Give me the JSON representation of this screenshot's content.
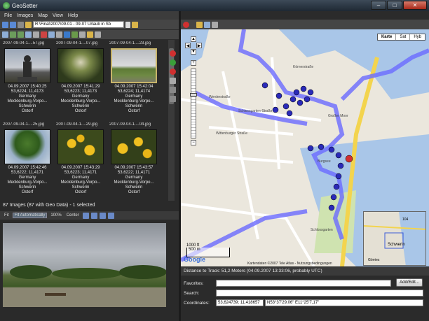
{
  "window": {
    "title": "GeoSetter",
    "minimize": "–",
    "maximize": "□",
    "close": "✕"
  },
  "menu": [
    "File",
    "Images",
    "Map",
    "View",
    "Help"
  ],
  "toolbar": {
    "path": "R:\\Final\\2007\\09-01 - 09-07 Urlaub in Sb"
  },
  "thumbnails": [
    {
      "file": "2007-09-04-1....57.jpg",
      "date": "04.09.2007 15:40:25",
      "coords": "53,6224; 11,4173",
      "country": "Germany",
      "region": "Mecklenburg-Vorpo...",
      "city": "Schwerin",
      "district": "Ostorf",
      "selected": false
    },
    {
      "file": "2007-09-04-1....07.jpg",
      "date": "04.09.2007 15:41:29",
      "coords": "53,6223; 11,4173",
      "country": "Germany",
      "region": "Mecklenburg-Vorpo...",
      "city": "Schwerin",
      "district": "Ostorf",
      "selected": false
    },
    {
      "file": "2007-09-04-1....23.jpg",
      "date": "04.09.2007 15:42:04",
      "coords": "53,6224; 11,4174",
      "country": "Germany",
      "region": "Mecklenburg-Vorpo...",
      "city": "Schwerin",
      "district": "Ostorf",
      "selected": true
    },
    {
      "file": "2007-09-04-1....25.jpg",
      "date": "04.09.2007 15:42:46",
      "coords": "53,6222; 11,4171",
      "country": "Germany",
      "region": "Mecklenburg-Vorpo...",
      "city": "Schwerin",
      "district": "Ostorf",
      "selected": false
    },
    {
      "file": "2007-09-04-1....29.jpg",
      "date": "04.09.2007 15:43:29",
      "coords": "53,6223; 11,4171",
      "country": "Germany",
      "region": "Mecklenburg-Vorpo...",
      "city": "Schwerin",
      "district": "Ostorf",
      "selected": false
    },
    {
      "file": "2007-09-04-1....04.jpg",
      "date": "04.09.2007 15:43:57",
      "coords": "53,6222; 11,4171",
      "country": "Germany",
      "region": "Mecklenburg-Vorpo...",
      "city": "Schwerin",
      "district": "Ostorf",
      "selected": false
    }
  ],
  "status": {
    "images": "87 Images (87 with Geo Data) - 1 selected"
  },
  "preview_bar": {
    "fit": "Fit",
    "fit_auto": "Fit Automatically",
    "zoom": "100%",
    "center": "Center"
  },
  "map": {
    "tabs": [
      {
        "label": "Karte",
        "active": true
      },
      {
        "label": "Sat",
        "active": false
      },
      {
        "label": "Hyb",
        "active": false
      }
    ],
    "scale": "1000 ft",
    "scale_m": "500 m",
    "logo": "Google",
    "copyright": "Kartendaten ©2007 Tele Atlas - Nutzungsbedingungen",
    "minimap_label": "Schwerin",
    "minimap_road": "104",
    "minimap_town": "Görries",
    "zoom_in": "+",
    "zoom_out": "−",
    "streets": [
      "Schlossgarten",
      "Burgsee",
      "Schlossgarten-Straße",
      "Großer Moor",
      "Werderstraße",
      "Körnerstraße",
      "Wittenburger Straße"
    ]
  },
  "distance": "Distance to Track: 51,2 Meters (04.09.2007 13:33:06, probably UTC)",
  "fields": {
    "favorites_label": "Favorites:",
    "favorites_value": "",
    "search_label": "Search:",
    "search_value": "",
    "coords_label": "Coordinates:",
    "coords_decimal": "53,624739; 11,418657",
    "coords_dms": "N53°37'29,06\" E11°25'7,17\"",
    "add_edit": "Add/Edit..."
  },
  "colors": {
    "track": "#6a6aff",
    "marker": "#2a2ab8",
    "marker_selected": "#d03030",
    "water": "#a9c6e8",
    "park": "#cfe3b0"
  }
}
